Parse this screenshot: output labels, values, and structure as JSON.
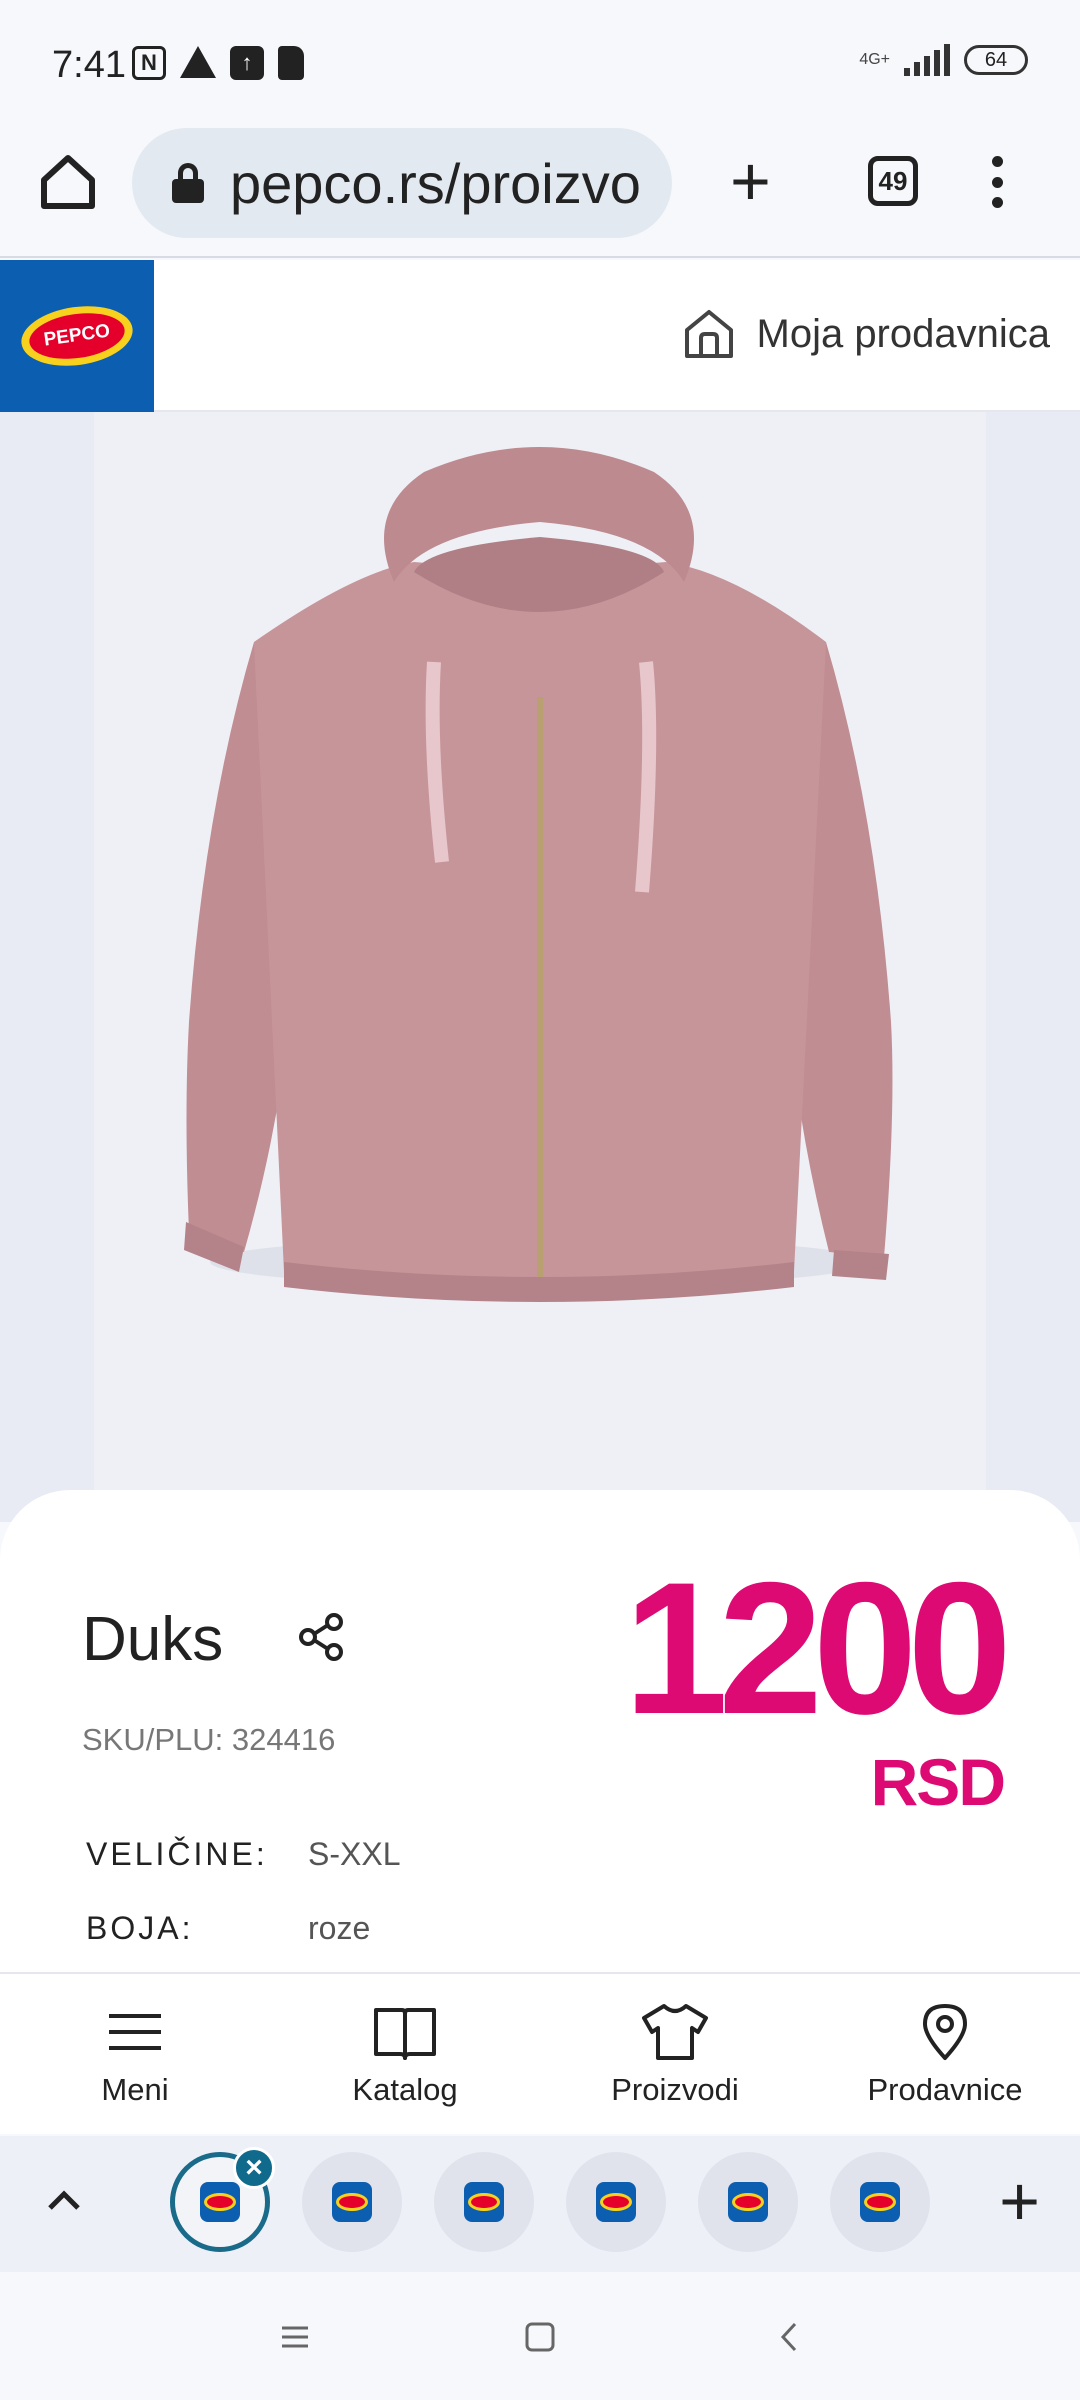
{
  "status_bar": {
    "time": "7:41",
    "network": "4G+",
    "battery": "64"
  },
  "browser": {
    "url": "pepco.rs/proizvo",
    "tab_count": "49"
  },
  "site_header": {
    "logo_text": "PEPCO",
    "store_label": "Moja prodavnica"
  },
  "product": {
    "title": "Duks",
    "sku": "SKU/PLU: 324416",
    "price": "1200",
    "currency": "RSD",
    "attributes": [
      {
        "label": "VELIČINE:",
        "value": "S-XXL"
      },
      {
        "label": "BOJA:",
        "value": "roze"
      }
    ],
    "image_color": "#c6959a"
  },
  "site_nav": {
    "items": [
      {
        "label": "Meni",
        "icon": "hamburger-icon"
      },
      {
        "label": "Katalog",
        "icon": "book-icon"
      },
      {
        "label": "Proizvodi",
        "icon": "tshirt-icon"
      },
      {
        "label": "Prodavnice",
        "icon": "location-pin-icon"
      }
    ]
  },
  "colors": {
    "price": "#dd0a73",
    "brand_blue": "#0c5fb0",
    "brand_red": "#e4002b",
    "brand_yellow": "#f7d11e"
  }
}
